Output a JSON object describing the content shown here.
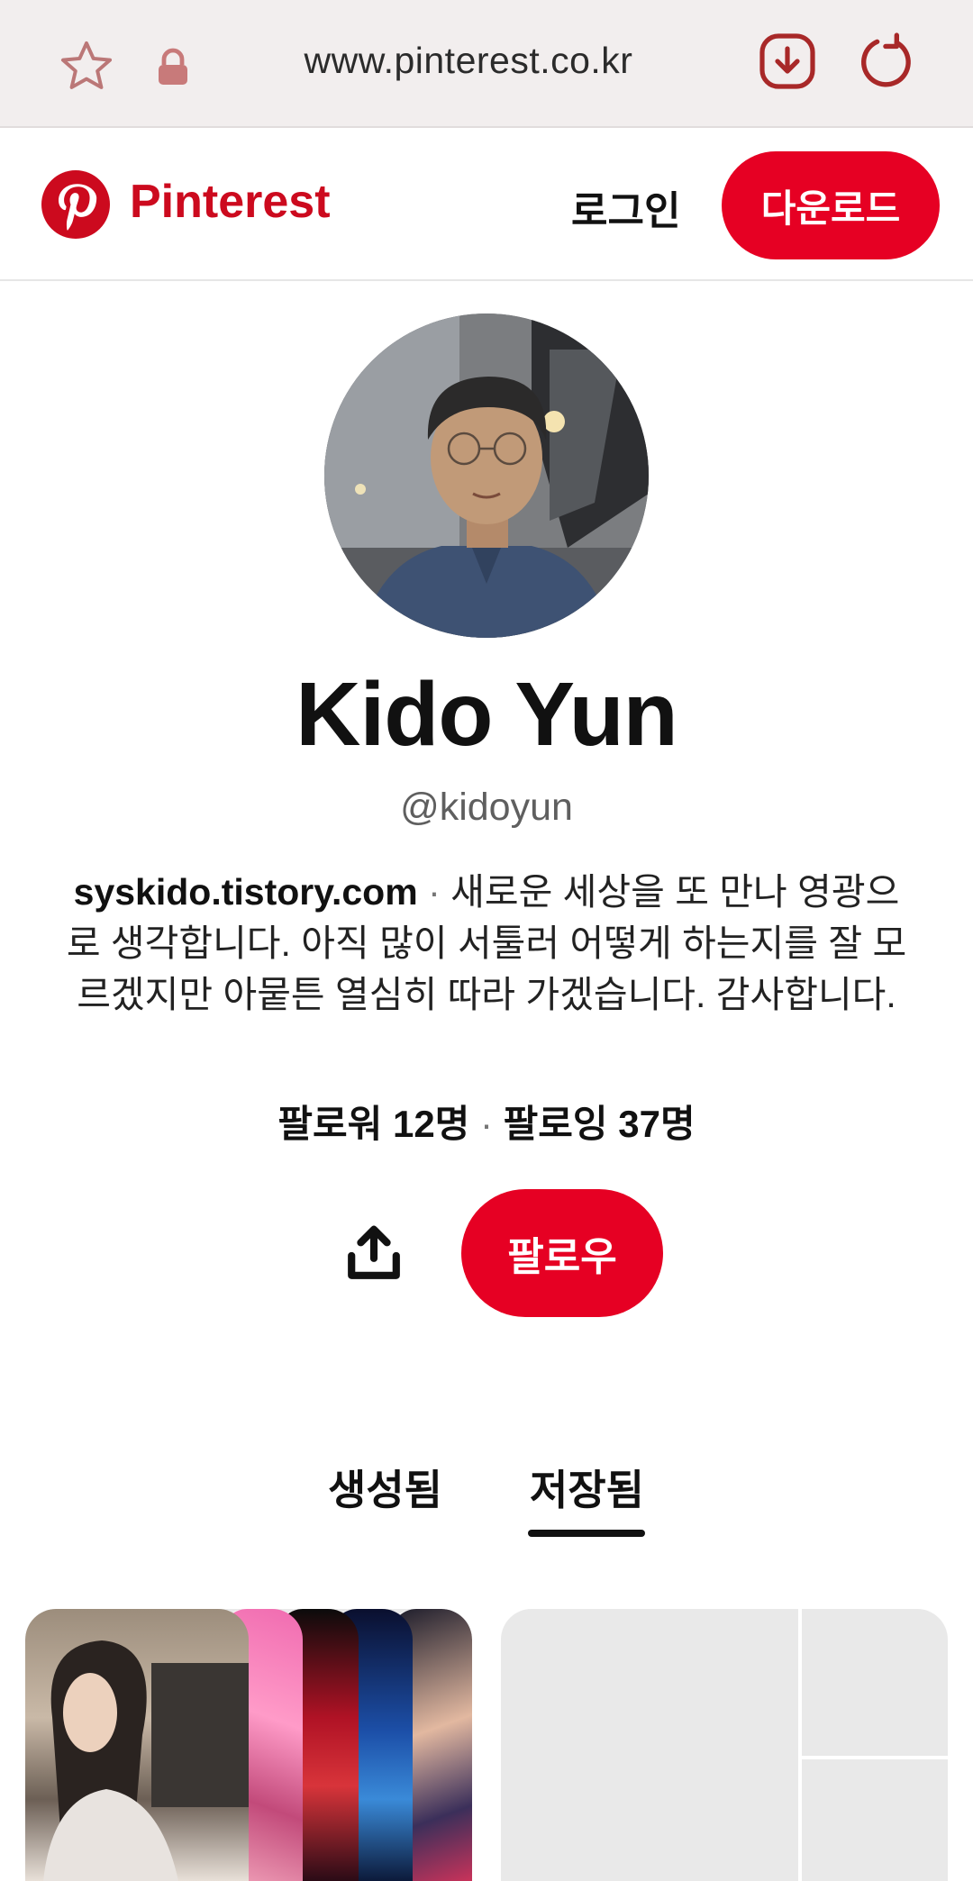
{
  "browser": {
    "url": "www.pinterest.co.kr",
    "icons": [
      "star-icon",
      "lock-icon",
      "download-icon",
      "reload-icon"
    ]
  },
  "header": {
    "brand": "Pinterest",
    "login": "로그인",
    "download": "다운로드"
  },
  "profile": {
    "name": "Kido Yun",
    "handle": "@kidoyun",
    "website": "syskido.tistory.com",
    "separator": " · ",
    "bio": "새로운 세상을 또 만나 영광으로 생각합니다. 아직 많이 서툴러 어떻게 하는지를 잘 모르겠지만 아뭍튼 열심히 따라 가겠습니다. 감사합니다.",
    "followers": "팔로워 12명",
    "following": "팔로잉 37명",
    "follow_button": "팔로우"
  },
  "tabs": [
    {
      "label": "생성됨",
      "active": false
    },
    {
      "label": "저장됨",
      "active": true
    }
  ],
  "colors": {
    "brand_red": "#e60023",
    "logo_red": "#cc0a1e",
    "browser_icon": "#b43a3a"
  }
}
